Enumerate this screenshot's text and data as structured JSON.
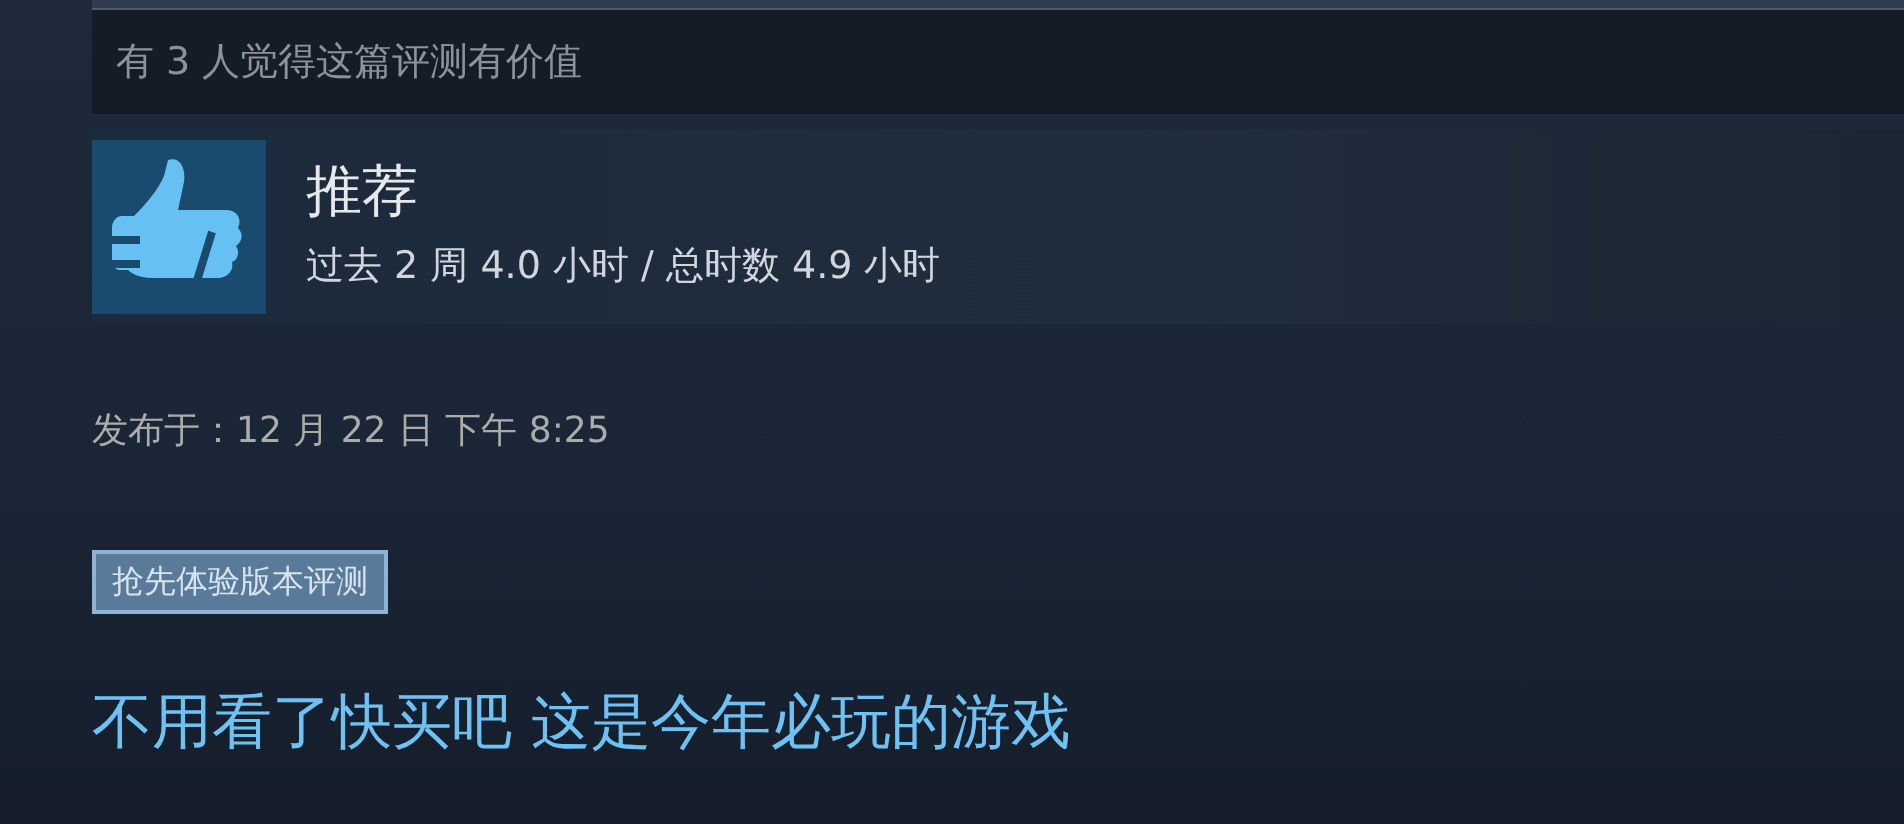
{
  "helpful": "有 3 人觉得这篇评测有价值",
  "verdict": {
    "title": "推荐",
    "recommended": true,
    "hours": "过去 2 周 4.0 小时 / 总时数 4.9 小时"
  },
  "posted": "发布于：12 月 22 日 下午 8:25",
  "tag": "抢先体验版本评测",
  "review_text": "不用看了快买吧 这是今年必玩的游戏"
}
